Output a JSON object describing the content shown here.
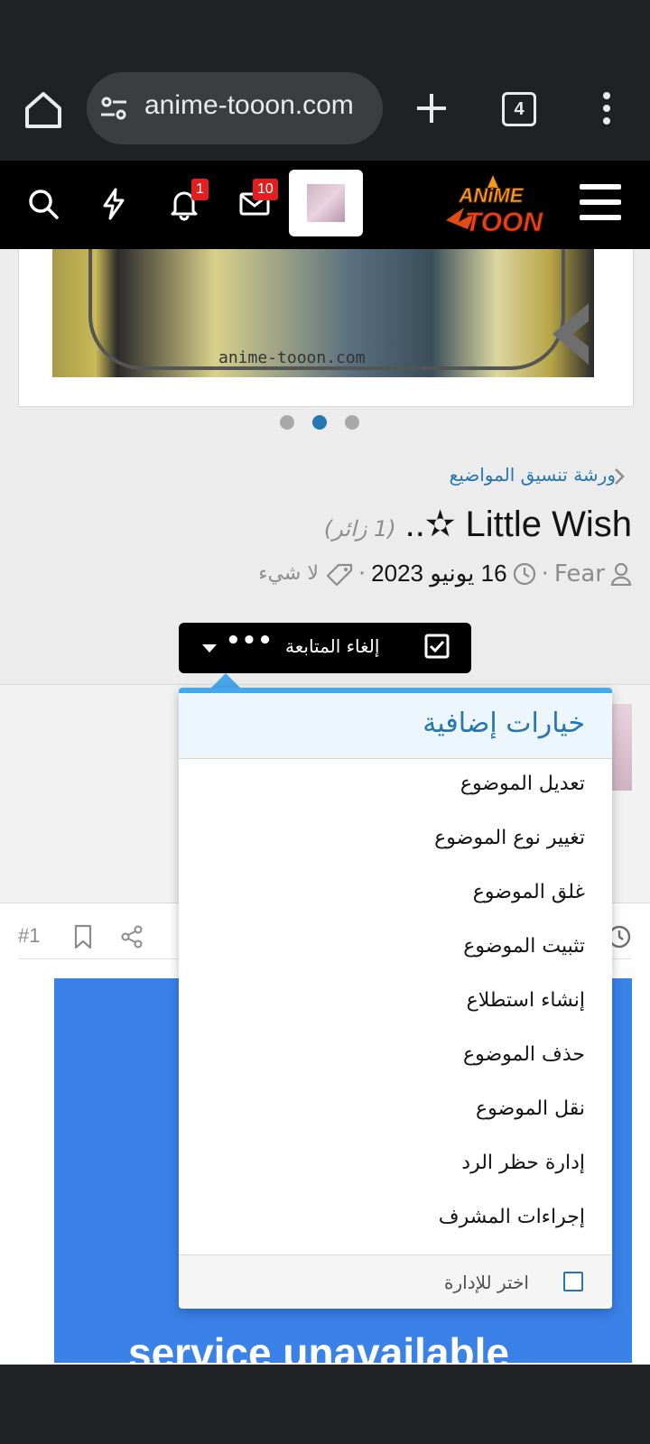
{
  "browser": {
    "url": "anime-tooon.com",
    "tab_count": "4"
  },
  "header": {
    "notifications_badge": "1",
    "messages_badge": "10",
    "logo_alt": "Anime Toon"
  },
  "slider": {
    "watermark": "anime-tooon.com",
    "active_index": 2,
    "count": 3
  },
  "thread": {
    "breadcrumb": "ورشة تنسيق المواضيع",
    "title": "..✫ Little Wish",
    "visitors": "(1 زائر)",
    "author": "Fear",
    "date": "16 يونيو 2023",
    "tags": "لا شيء",
    "separator": "·"
  },
  "watch": {
    "label": "إلغاء المتابعة",
    "more": "•••"
  },
  "dropdown": {
    "title": "خيارات إضافية",
    "items": [
      "تعديل الموضوع",
      "تغيير نوع الموضوع",
      "غلق الموضوع",
      "تثبيت الموضوع",
      "إنشاء استطلاع",
      "حذف الموضوع",
      "نقل الموضوع",
      "إدارة حظر الرد",
      "إجراءات المشرف"
    ],
    "select_label": "اختر للإدارة"
  },
  "post": {
    "number": "#1",
    "image_text": "service unavailable"
  },
  "colors": {
    "accent": "#2577b1",
    "dropdown_border": "#47a7eb",
    "badge": "#e02020"
  }
}
